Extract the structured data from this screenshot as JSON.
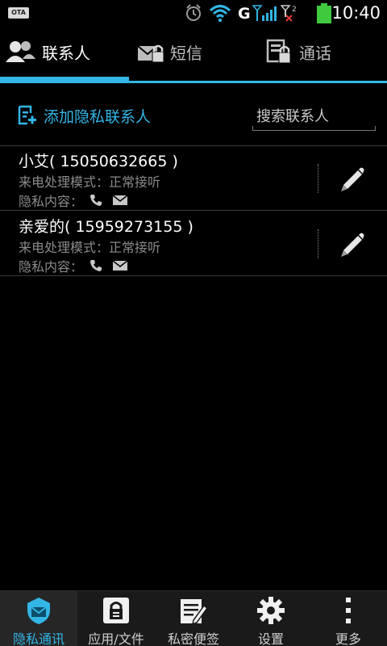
{
  "status_bar": {
    "ota_badge": "OTA",
    "time": "10:40",
    "icons": [
      "alarm-icon",
      "wifi-icon",
      "g-signal-icon",
      "signal-bars-icon",
      "sim2-no-signal-icon",
      "battery-icon"
    ]
  },
  "tabs": [
    {
      "label": "联系人",
      "icon": "contacts-icon"
    },
    {
      "label": "短信",
      "icon": "sms-lock-icon"
    },
    {
      "label": "通话",
      "icon": "call-log-lock-icon"
    }
  ],
  "actions": {
    "add_label": "添加隐私联系人",
    "search_placeholder": "搜索联系人"
  },
  "contacts": [
    {
      "name": "小艾( 15050632665 )",
      "mode": "来电处理模式：正常接听",
      "privacy": "隐私内容："
    },
    {
      "name": "亲爱的( 15959273155 )",
      "mode": "来电处理模式：正常接听",
      "privacy": "隐私内容："
    }
  ],
  "bottom_nav": [
    {
      "label": "隐私通讯",
      "icon": "private-comm-icon"
    },
    {
      "label": "应用/文件",
      "icon": "app-lock-icon"
    },
    {
      "label": "私密便签",
      "icon": "notes-icon"
    },
    {
      "label": "设置",
      "icon": "gear-icon"
    },
    {
      "label": "更多",
      "icon": "more-icon"
    }
  ],
  "colors": {
    "accent": "#33b5e5",
    "background": "#000000",
    "secondary_text": "#8a8a8a",
    "battery": "#3fc93f",
    "no_signal": "#e53935"
  }
}
